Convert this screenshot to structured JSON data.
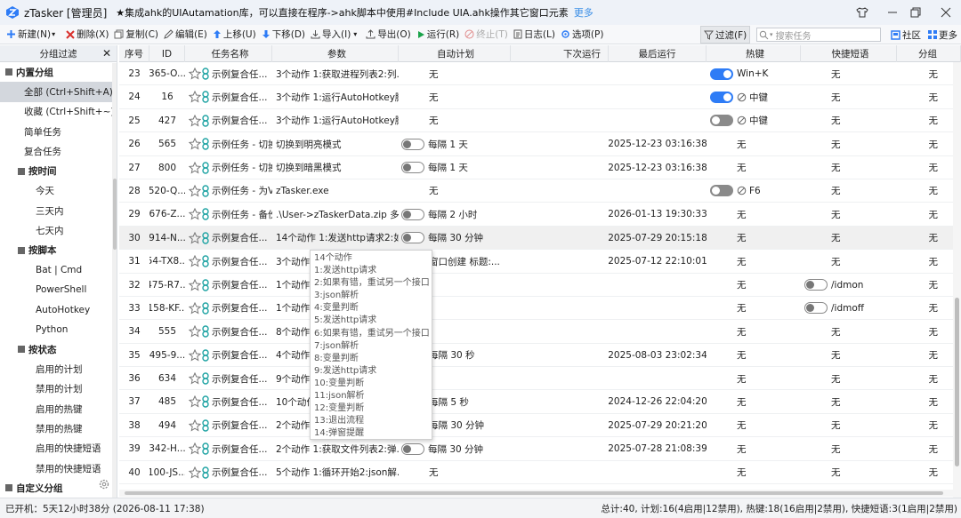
{
  "title": {
    "app": "zTasker [管理员]",
    "notice": "★集成ahk的UIAutamation库，可以直接在程序->ahk脚本中使用#Include UIA.ahk操作其它窗口元素",
    "more": "更多"
  },
  "toolbar": {
    "new": "新建(N)",
    "delete": "删除(X)",
    "copy": "复制(C)",
    "edit": "编辑(E)",
    "up": "上移(U)",
    "down": "下移(D)",
    "import": "导入(I)",
    "export": "导出(O)",
    "run": "运行(R)",
    "stop": "终止(T)",
    "log": "日志(L)",
    "options": "选项(P)",
    "filter": "过滤(F)",
    "search_placeholder": "搜索任务",
    "community": "社区",
    "more": "更多"
  },
  "sidebar": {
    "header": "分组过滤",
    "items": [
      {
        "label": "内置分组",
        "kind": "group"
      },
      {
        "label": "全部 (Ctrl+Shift+A)",
        "kind": "sub",
        "active": true
      },
      {
        "label": "收藏 (Ctrl+Shift+~)",
        "kind": "sub"
      },
      {
        "label": "简单任务",
        "kind": "sub"
      },
      {
        "label": "复合任务",
        "kind": "sub"
      },
      {
        "label": "按时间",
        "kind": "subgroup"
      },
      {
        "label": "今天",
        "kind": "leaf"
      },
      {
        "label": "三天内",
        "kind": "leaf"
      },
      {
        "label": "七天内",
        "kind": "leaf"
      },
      {
        "label": "按脚本",
        "kind": "subgroup"
      },
      {
        "label": "Bat | Cmd",
        "kind": "leaf"
      },
      {
        "label": "PowerShell",
        "kind": "leaf"
      },
      {
        "label": "AutoHotkey",
        "kind": "leaf"
      },
      {
        "label": "Python",
        "kind": "leaf"
      },
      {
        "label": "按状态",
        "kind": "subgroup"
      },
      {
        "label": "启用的计划",
        "kind": "leaf"
      },
      {
        "label": "禁用的计划",
        "kind": "leaf"
      },
      {
        "label": "启用的热键",
        "kind": "leaf"
      },
      {
        "label": "禁用的热键",
        "kind": "leaf"
      },
      {
        "label": "启用的快捷短语",
        "kind": "leaf"
      },
      {
        "label": "禁用的快捷短语",
        "kind": "leaf"
      },
      {
        "label": "自定义分组",
        "kind": "group"
      }
    ]
  },
  "table": {
    "columns": [
      "序号",
      "ID",
      "任务名称",
      "参数",
      "自动计划",
      "下次运行",
      "最后运行",
      "热键",
      "快捷短语",
      "分组"
    ],
    "rows": [
      {
        "seq": "23",
        "id": "365-O...",
        "name": "示例复合任...",
        "params": "3个动作 1:获取进程列表2:列...",
        "plan": "无",
        "plan_toggle": "",
        "next": "",
        "last": "",
        "hot_toggle": "on",
        "hot_ban": false,
        "hot": "Win+K",
        "phrase_toggle": "",
        "phrase": "无",
        "group": "无"
      },
      {
        "seq": "24",
        "id": "16",
        "name": "示例复合任...",
        "params": "3个动作 1:运行AutoHotkey脚...",
        "plan": "无",
        "plan_toggle": "",
        "next": "",
        "last": "",
        "hot_toggle": "on",
        "hot_ban": true,
        "hot": "中键",
        "phrase_toggle": "",
        "phrase": "无",
        "group": "无"
      },
      {
        "seq": "25",
        "id": "427",
        "name": "示例复合任...",
        "params": "3个动作 1:运行AutoHotkey脚...",
        "plan": "无",
        "plan_toggle": "",
        "next": "",
        "last": "",
        "hot_toggle": "offdark",
        "hot_ban": true,
        "hot": "中键",
        "phrase_toggle": "",
        "phrase": "无",
        "group": "无"
      },
      {
        "seq": "26",
        "id": "565",
        "name": "示例任务 - 切换...",
        "params": "切换到明亮模式",
        "plan": "每隔 1 天",
        "plan_toggle": "off",
        "next": "",
        "last": "2025-12-23 03:16:38",
        "hot_toggle": "",
        "hot_ban": false,
        "hot": "无",
        "phrase_toggle": "",
        "phrase": "无",
        "group": "无"
      },
      {
        "seq": "27",
        "id": "800",
        "name": "示例任务 - 切换...",
        "params": "切换到暗黑模式",
        "plan": "每隔 1 天",
        "plan_toggle": "off",
        "next": "",
        "last": "2025-12-23 03:16:38",
        "hot_toggle": "",
        "hot_ban": false,
        "hot": "无",
        "phrase_toggle": "",
        "phrase": "无",
        "group": "无"
      },
      {
        "seq": "28",
        "id": "520-Q...",
        "name": "示例任务 - 为V...",
        "params": "zTasker.exe",
        "plan": "无",
        "plan_toggle": "",
        "next": "",
        "last": "",
        "hot_toggle": "offdark",
        "hot_ban": true,
        "hot": "F6",
        "phrase_toggle": "",
        "phrase": "无",
        "group": "无"
      },
      {
        "seq": "29",
        "id": "676-Z...",
        "name": "示例任务 - 备份...",
        "params": ".\\User->zTaskerData.zip 多...",
        "plan": "每隔 2 小时",
        "plan_toggle": "off",
        "next": "",
        "last": "2026-01-13 19:30:33",
        "hot_toggle": "",
        "hot_ban": false,
        "hot": "无",
        "phrase_toggle": "",
        "phrase": "无",
        "group": "无"
      },
      {
        "seq": "30",
        "id": "914-N...",
        "name": "示例复合任...",
        "params": "14个动作 1:发送http请求2:如...",
        "plan": "每隔 30 分钟",
        "plan_toggle": "off",
        "next": "",
        "last": "2025-07-29 20:15:18",
        "hot_toggle": "",
        "hot_ban": false,
        "hot": "无",
        "phrase_toggle": "",
        "phrase": "无",
        "group": "无",
        "highlight": true
      },
      {
        "seq": "31",
        "id": "54-TX8...",
        "name": "示例复合任...",
        "params": "3个动作",
        "plan": "窗口创建 标题:...",
        "plan_toggle": "",
        "next": "",
        "last": "2025-07-12 22:10:01",
        "hot_toggle": "",
        "hot_ban": false,
        "hot": "无",
        "phrase_toggle": "",
        "phrase": "无",
        "group": "无"
      },
      {
        "seq": "32",
        "id": "475-R7...",
        "name": "示例复合任...",
        "params": "1个动作",
        "plan": "",
        "plan_toggle": "",
        "next": "",
        "last": "",
        "hot_toggle": "",
        "hot_ban": false,
        "hot": "无",
        "phrase_toggle": "off",
        "phrase": "/idmon",
        "group": "无"
      },
      {
        "seq": "33",
        "id": "158-KF...",
        "name": "示例复合任...",
        "params": "1个动作",
        "plan": "",
        "plan_toggle": "",
        "next": "",
        "last": "",
        "hot_toggle": "",
        "hot_ban": false,
        "hot": "无",
        "phrase_toggle": "off",
        "phrase": "/idmoff",
        "group": "无"
      },
      {
        "seq": "34",
        "id": "555",
        "name": "示例复合任...",
        "params": "8个动作",
        "plan": "",
        "plan_toggle": "",
        "next": "",
        "last": "",
        "hot_toggle": "",
        "hot_ban": false,
        "hot": "无",
        "phrase_toggle": "",
        "phrase": "无",
        "group": "无"
      },
      {
        "seq": "35",
        "id": "495-9...",
        "name": "示例复合任...",
        "params": "4个动作",
        "plan": "每隔 30 秒",
        "plan_toggle": "",
        "next": "",
        "last": "2025-08-03 23:02:34",
        "hot_toggle": "",
        "hot_ban": false,
        "hot": "无",
        "phrase_toggle": "",
        "phrase": "无",
        "group": "无"
      },
      {
        "seq": "36",
        "id": "634",
        "name": "示例复合任...",
        "params": "9个动作",
        "plan": "",
        "plan_toggle": "",
        "next": "",
        "last": "",
        "hot_toggle": "",
        "hot_ban": false,
        "hot": "无",
        "phrase_toggle": "",
        "phrase": "无",
        "group": "无"
      },
      {
        "seq": "37",
        "id": "485",
        "name": "示例复合任...",
        "params": "10个动作",
        "plan": "每隔 5 秒",
        "plan_toggle": "",
        "next": "",
        "last": "2024-12-26 22:04:20",
        "hot_toggle": "",
        "hot_ban": false,
        "hot": "无",
        "phrase_toggle": "",
        "phrase": "无",
        "group": "无"
      },
      {
        "seq": "38",
        "id": "494",
        "name": "示例复合任...",
        "params": "2个动作",
        "plan": "每隔 30 分钟",
        "plan_toggle": "",
        "next": "",
        "last": "2025-07-29 20:21:20",
        "hot_toggle": "",
        "hot_ban": false,
        "hot": "无",
        "phrase_toggle": "",
        "phrase": "无",
        "group": "无"
      },
      {
        "seq": "39",
        "id": "342-H...",
        "name": "示例复合任...",
        "params": "2个动作 1:获取文件列表2:弹...",
        "plan": "每隔 30 分钟",
        "plan_toggle": "off",
        "next": "",
        "last": "2025-07-28 21:08:39",
        "hot_toggle": "",
        "hot_ban": false,
        "hot": "无",
        "phrase_toggle": "",
        "phrase": "无",
        "group": "无"
      },
      {
        "seq": "40",
        "id": "100-JS...",
        "name": "示例复合任...",
        "params": "5个动作 1:循环开始2:json解...",
        "plan": "无",
        "plan_toggle": "",
        "next": "",
        "last": "",
        "hot_toggle": "",
        "hot_ban": false,
        "hot": "无",
        "phrase_toggle": "",
        "phrase": "无",
        "group": "无"
      }
    ]
  },
  "tooltip": {
    "lines": [
      "14个动作",
      "1:发送http请求",
      "2:如果有错，重试另一个接口",
      "3:json解析",
      "4:变量判断",
      "5:发送http请求",
      "6:如果有错，重试另一个接口",
      "7:json解析",
      "8:变量判断",
      "9:发送http请求",
      "10:变量判断",
      "11:json解析",
      "12:变量判断",
      "13:退出流程",
      "14:弹窗提醒"
    ]
  },
  "status": {
    "uptime": "已开机：5天12小时38分 (2026-08-11 17:38)",
    "summary": "总计:40, 计划:16(4启用|12禁用), 热键:18(16启用|2禁用), 快捷短语:3(1启用|2禁用)"
  },
  "colors": {
    "accent": "#2e7cf6",
    "run_green": "#1aa34a",
    "delete_red": "#d9302c",
    "link_teal": "#1fa3a3"
  }
}
